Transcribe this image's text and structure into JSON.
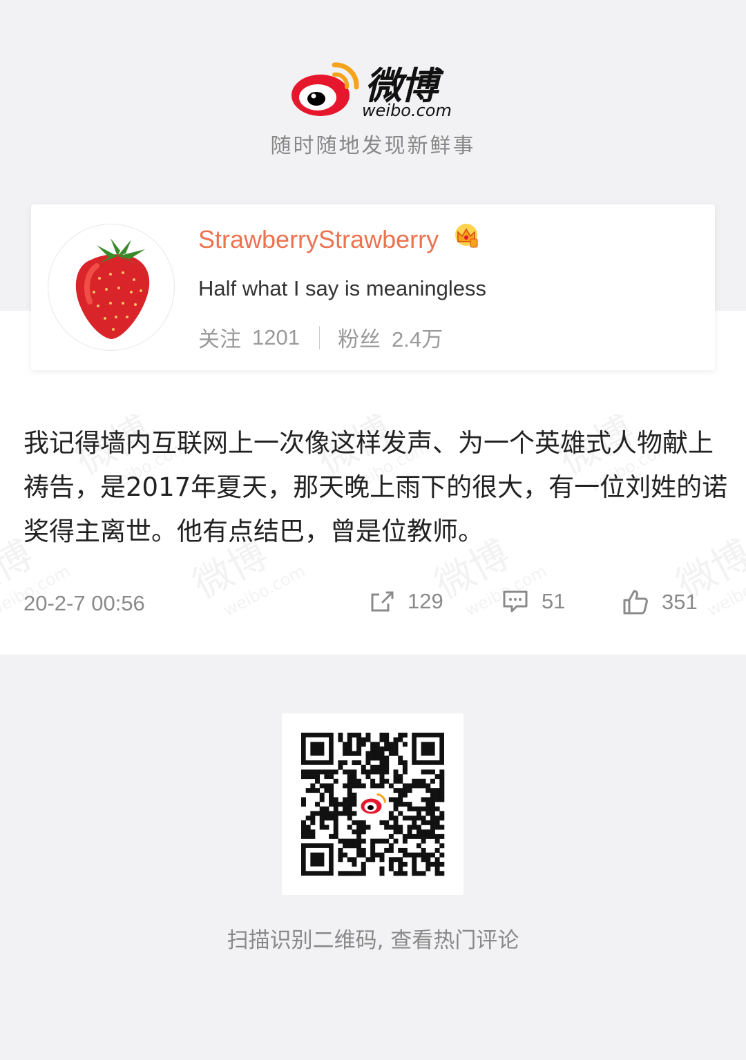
{
  "brand": {
    "name_cn": "微博",
    "domain": "weibo.com",
    "slogan": "随时随地发现新鲜事",
    "accent": "#e6162d"
  },
  "profile": {
    "username": "StrawberryStrawberry",
    "badge": "crown-icon",
    "bio": "Half what I say is meaningless",
    "following_label": "关注",
    "following_count": "1201",
    "followers_label": "粉丝",
    "followers_count": "2.4万",
    "name_color": "#eb7350"
  },
  "post": {
    "text": "我记得墙内互联网上一次像这样发声、为一个英雄式人物献上祷告，是2017年夏天，那天晚上雨下的很大，有一位刘姓的诺奖得主离世。他有点结巴，曾是位教师。",
    "time": "20-2-7 00:56",
    "reposts": "129",
    "comments": "51",
    "likes": "351"
  },
  "footer": {
    "scan_text": "扫描识别二维码, 查看热门评论"
  }
}
